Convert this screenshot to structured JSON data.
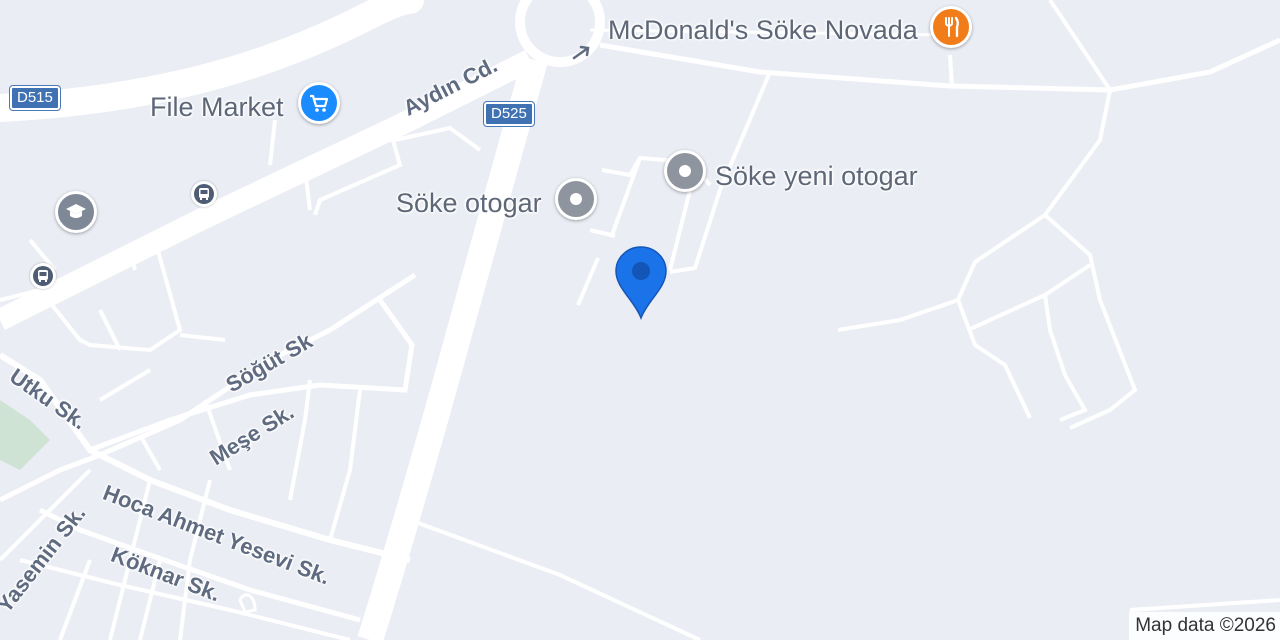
{
  "map": {
    "attribution": "Map data ©2026",
    "colors": {
      "background": "#eaedf4",
      "road": "#ffffff",
      "park": "#cfe3d4",
      "road_label": "#5f6b80",
      "shield_blue": "#3f71b3",
      "shopping_pin": "#1a8cff",
      "restaurant_pin": "#f07c1a",
      "place_pin": "#8e959f",
      "education_pin": "#7e8896",
      "transit_icon": "#4e5d73",
      "selected_marker": "#1a73e8"
    }
  },
  "pois": {
    "mcdonalds": {
      "name": "McDonald's Söke Novada",
      "icon": "fork-knife-icon"
    },
    "file_market": {
      "name": "File Market",
      "icon": "shopping-cart-icon"
    },
    "soke_otogar": {
      "name": "Söke otogar",
      "icon": "place-dot-icon"
    },
    "soke_yeni_otogar": {
      "name": "Söke yeni otogar",
      "icon": "place-dot-icon"
    },
    "school": {
      "icon": "graduation-cap-icon"
    }
  },
  "streets": {
    "aydin_cd": "Aydın Cd.",
    "sogut_sk": "Söğüt Sk",
    "utku_sk": "Utku Sk.",
    "mese_sk": "Meşe Sk.",
    "hoca_ahmet_yesevi_sk": "Hoca Ahmet Yesevi Sk.",
    "koknar_sk": "Köknar Sk.",
    "yasemin_sk": "Yasemin Sk."
  },
  "route_shields": {
    "d515": "D515",
    "d525": "D525"
  },
  "transit": [
    {
      "icon": "bus-icon"
    },
    {
      "icon": "bus-icon"
    }
  ],
  "selected_marker": {
    "icon": "location-pin-icon"
  }
}
